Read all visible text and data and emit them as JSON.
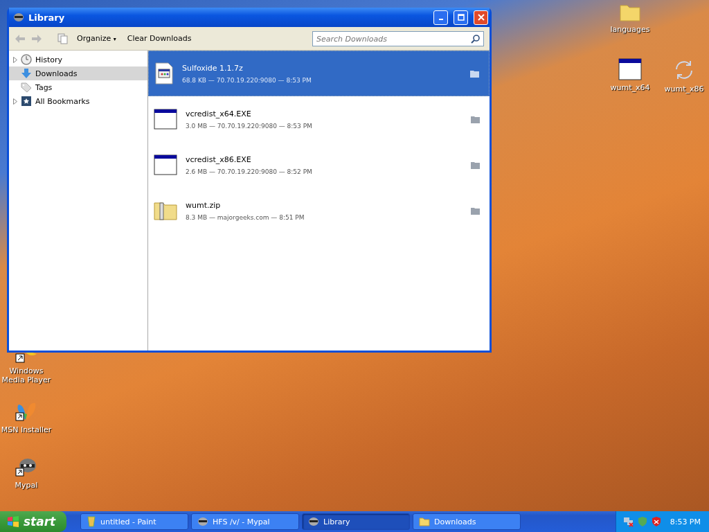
{
  "desktop_icons": [
    {
      "label": "languages",
      "kind": "folder"
    },
    {
      "label": "wumt_x64",
      "kind": "app"
    },
    {
      "label": "wumt_x86",
      "kind": "refresh"
    },
    {
      "label": "Windows Media Player",
      "kind": "media"
    },
    {
      "label": "MSN Installer",
      "kind": "butterfly"
    },
    {
      "label": "Mypal",
      "kind": "raccoon"
    }
  ],
  "window": {
    "title": "Library"
  },
  "toolbar": {
    "organize": "Organize",
    "organize_caret": "▾",
    "clear": "Clear Downloads",
    "search": {
      "placeholder": "Search Downloads"
    }
  },
  "sidebar": {
    "items": [
      {
        "label": "History",
        "kind": "history",
        "expandable": true,
        "selected": false
      },
      {
        "label": "Downloads",
        "kind": "downloads",
        "expandable": false,
        "selected": true
      },
      {
        "label": "Tags",
        "kind": "tags",
        "expandable": false,
        "selected": false
      },
      {
        "label": "All Bookmarks",
        "kind": "bookmarks",
        "expandable": true,
        "selected": false
      }
    ]
  },
  "downloads": [
    {
      "name": "Sulfoxide 1.1.7z",
      "details": "68.8 KB — 70.70.19.220:9080 — 8:53 PM",
      "kind": "archive",
      "selected": true
    },
    {
      "name": "vcredist_x64.EXE",
      "details": "3.0 MB — 70.70.19.220:9080 — 8:53 PM",
      "kind": "exe",
      "selected": false
    },
    {
      "name": "vcredist_x86.EXE",
      "details": "2.6 MB — 70.70.19.220:9080 — 8:52 PM",
      "kind": "exe",
      "selected": false
    },
    {
      "name": "wumt.zip",
      "details": "8.3 MB — majorgeeks.com — 8:51 PM",
      "kind": "zip",
      "selected": false
    }
  ],
  "taskbar": {
    "start": "start",
    "tasks": [
      {
        "label": "untitled - Paint",
        "kind": "paint",
        "selected": false
      },
      {
        "label": "HFS /v/ - Mypal",
        "kind": "browser",
        "selected": false
      },
      {
        "label": "Library",
        "kind": "browser",
        "selected": true
      },
      {
        "label": "Downloads",
        "kind": "folder",
        "selected": false
      }
    ],
    "clock": "8:53 PM"
  }
}
